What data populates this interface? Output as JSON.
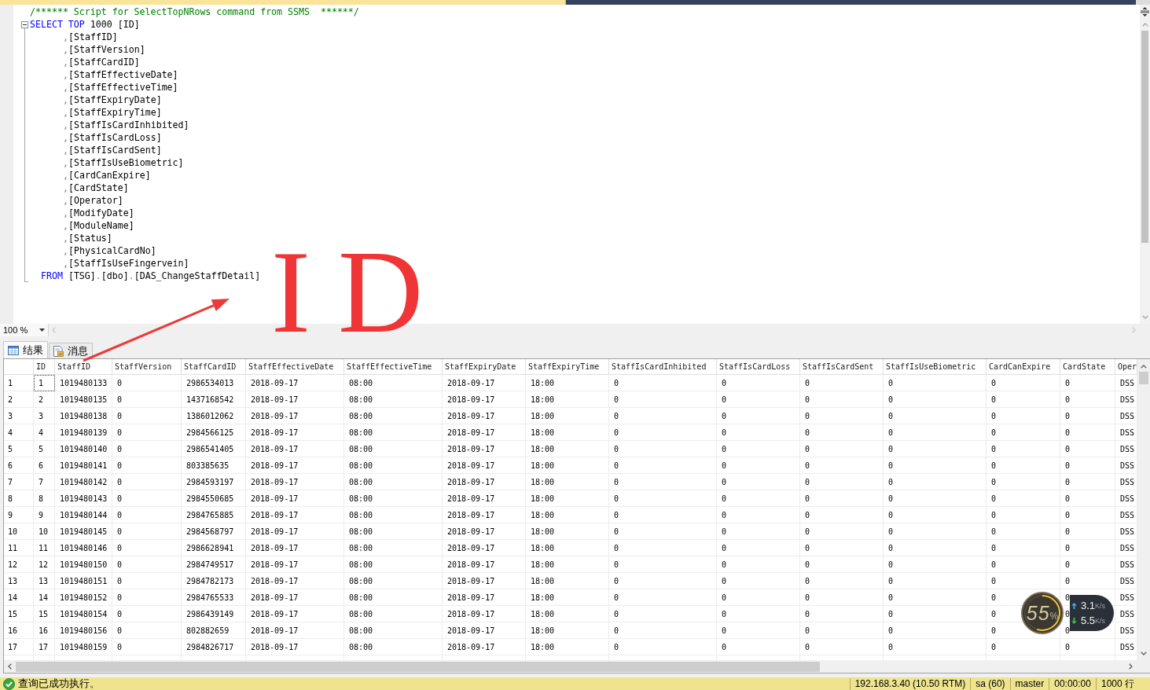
{
  "document_tabs": [
    {
      "selected": true
    },
    {
      "selected": false
    }
  ],
  "editor": {
    "fold_expanded": true,
    "lines": [
      {
        "kind": "head",
        "tokens": [
          {
            "kind": "comment",
            "text": "/****** Script for SelectTopNRows command from SSMS  ******/"
          }
        ]
      },
      {
        "kind": "head",
        "tokens": [
          {
            "kind": "keyword",
            "text": "SELECT TOP"
          },
          {
            "kind": "plain",
            "text": " 1000 [ID]"
          }
        ]
      },
      {
        "kind": "column",
        "tokens": [
          {
            "kind": "operator",
            "text": ","
          },
          {
            "kind": "plain",
            "text": "[StaffID]"
          }
        ]
      },
      {
        "kind": "column",
        "tokens": [
          {
            "kind": "operator",
            "text": ","
          },
          {
            "kind": "plain",
            "text": "[StaffVersion]"
          }
        ]
      },
      {
        "kind": "column",
        "tokens": [
          {
            "kind": "operator",
            "text": ","
          },
          {
            "kind": "plain",
            "text": "[StaffCardID]"
          }
        ]
      },
      {
        "kind": "column",
        "tokens": [
          {
            "kind": "operator",
            "text": ","
          },
          {
            "kind": "plain",
            "text": "[StaffEffectiveDate]"
          }
        ]
      },
      {
        "kind": "column",
        "tokens": [
          {
            "kind": "operator",
            "text": ","
          },
          {
            "kind": "plain",
            "text": "[StaffEffectiveTime]"
          }
        ]
      },
      {
        "kind": "column",
        "tokens": [
          {
            "kind": "operator",
            "text": ","
          },
          {
            "kind": "plain",
            "text": "[StaffExpiryDate]"
          }
        ]
      },
      {
        "kind": "column",
        "tokens": [
          {
            "kind": "operator",
            "text": ","
          },
          {
            "kind": "plain",
            "text": "[StaffExpiryTime]"
          }
        ]
      },
      {
        "kind": "column",
        "tokens": [
          {
            "kind": "operator",
            "text": ","
          },
          {
            "kind": "plain",
            "text": "[StaffIsCardInhibited]"
          }
        ]
      },
      {
        "kind": "column",
        "tokens": [
          {
            "kind": "operator",
            "text": ","
          },
          {
            "kind": "plain",
            "text": "[StaffIsCardLoss]"
          }
        ]
      },
      {
        "kind": "column",
        "tokens": [
          {
            "kind": "operator",
            "text": ","
          },
          {
            "kind": "plain",
            "text": "[StaffIsCardSent]"
          }
        ]
      },
      {
        "kind": "column",
        "tokens": [
          {
            "kind": "operator",
            "text": ","
          },
          {
            "kind": "plain",
            "text": "[StaffIsUseBiometric]"
          }
        ]
      },
      {
        "kind": "column",
        "tokens": [
          {
            "kind": "operator",
            "text": ","
          },
          {
            "kind": "plain",
            "text": "[CardCanExpire]"
          }
        ]
      },
      {
        "kind": "column",
        "tokens": [
          {
            "kind": "operator",
            "text": ","
          },
          {
            "kind": "plain",
            "text": "[CardState]"
          }
        ]
      },
      {
        "kind": "column",
        "tokens": [
          {
            "kind": "operator",
            "text": ","
          },
          {
            "kind": "plain",
            "text": "[Operator]"
          }
        ]
      },
      {
        "kind": "column",
        "tokens": [
          {
            "kind": "operator",
            "text": ","
          },
          {
            "kind": "plain",
            "text": "[ModifyDate]"
          }
        ]
      },
      {
        "kind": "column",
        "tokens": [
          {
            "kind": "operator",
            "text": ","
          },
          {
            "kind": "plain",
            "text": "[ModuleName]"
          }
        ]
      },
      {
        "kind": "column",
        "tokens": [
          {
            "kind": "operator",
            "text": ","
          },
          {
            "kind": "plain",
            "text": "[Status]"
          }
        ]
      },
      {
        "kind": "column",
        "tokens": [
          {
            "kind": "operator",
            "text": ","
          },
          {
            "kind": "plain",
            "text": "[PhysicalCardNo]"
          }
        ]
      },
      {
        "kind": "column",
        "tokens": [
          {
            "kind": "operator",
            "text": ","
          },
          {
            "kind": "plain",
            "text": "[StaffIsUseFingervein]"
          }
        ]
      },
      {
        "kind": "clause",
        "tokens": [
          {
            "kind": "keyword",
            "text": "FROM"
          },
          {
            "kind": "plain",
            "text": " [TSG]"
          },
          {
            "kind": "operator",
            "text": "."
          },
          {
            "kind": "plain",
            "text": "[dbo]"
          },
          {
            "kind": "operator",
            "text": "."
          },
          {
            "kind": "plain",
            "text": "[DAS_ChangeStaffDetail]"
          }
        ]
      }
    ]
  },
  "annotation": {
    "text": "ID"
  },
  "zoom": {
    "value": "100 %"
  },
  "result_tabs": [
    {
      "kind": "results",
      "label": "结果",
      "selected": true
    },
    {
      "kind": "messages",
      "label": "消息",
      "selected": false
    }
  ],
  "grid": {
    "columns": [
      "ID",
      "StaffID",
      "StaffVersion",
      "StaffCardID",
      "StaffEffectiveDate",
      "StaffEffectiveTime",
      "StaffExpiryDate",
      "StaffExpiryTime",
      "StaffIsCardInhibited",
      "StaffIsCardLoss",
      "StaffIsCardSent",
      "StaffIsUseBiometric",
      "CardCanExpire",
      "CardState",
      "Oper"
    ],
    "rows": [
      {
        "number": "1",
        "focused": true,
        "cells": [
          "1",
          "1019480133",
          "0",
          "2986534013",
          "2018-09-17",
          "08:00",
          "2018-09-17",
          "18:00",
          "0",
          "0",
          "0",
          "0",
          "0",
          "0",
          "DSS"
        ]
      },
      {
        "number": "2",
        "focused": false,
        "cells": [
          "2",
          "1019480135",
          "0",
          "1437168542",
          "2018-09-17",
          "08:00",
          "2018-09-17",
          "18:00",
          "0",
          "0",
          "0",
          "0",
          "0",
          "0",
          "DSS"
        ]
      },
      {
        "number": "3",
        "focused": false,
        "cells": [
          "3",
          "1019480138",
          "0",
          "1386012062",
          "2018-09-17",
          "08:00",
          "2018-09-17",
          "18:00",
          "0",
          "0",
          "0",
          "0",
          "0",
          "0",
          "DSS"
        ]
      },
      {
        "number": "4",
        "focused": false,
        "cells": [
          "4",
          "1019480139",
          "0",
          "2984566125",
          "2018-09-17",
          "08:00",
          "2018-09-17",
          "18:00",
          "0",
          "0",
          "0",
          "0",
          "0",
          "0",
          "DSS"
        ]
      },
      {
        "number": "5",
        "focused": false,
        "cells": [
          "5",
          "1019480140",
          "0",
          "2986541405",
          "2018-09-17",
          "08:00",
          "2018-09-17",
          "18:00",
          "0",
          "0",
          "0",
          "0",
          "0",
          "0",
          "DSS"
        ]
      },
      {
        "number": "6",
        "focused": false,
        "cells": [
          "6",
          "1019480141",
          "0",
          "803385635",
          "2018-09-17",
          "08:00",
          "2018-09-17",
          "18:00",
          "0",
          "0",
          "0",
          "0",
          "0",
          "0",
          "DSS"
        ]
      },
      {
        "number": "7",
        "focused": false,
        "cells": [
          "7",
          "1019480142",
          "0",
          "2984593197",
          "2018-09-17",
          "08:00",
          "2018-09-17",
          "18:00",
          "0",
          "0",
          "0",
          "0",
          "0",
          "0",
          "DSS"
        ]
      },
      {
        "number": "8",
        "focused": false,
        "cells": [
          "8",
          "1019480143",
          "0",
          "2984550685",
          "2018-09-17",
          "08:00",
          "2018-09-17",
          "18:00",
          "0",
          "0",
          "0",
          "0",
          "0",
          "0",
          "DSS"
        ]
      },
      {
        "number": "9",
        "focused": false,
        "cells": [
          "9",
          "1019480144",
          "0",
          "2984765885",
          "2018-09-17",
          "08:00",
          "2018-09-17",
          "18:00",
          "0",
          "0",
          "0",
          "0",
          "0",
          "0",
          "DSS"
        ]
      },
      {
        "number": "10",
        "focused": false,
        "cells": [
          "10",
          "1019480145",
          "0",
          "2984568797",
          "2018-09-17",
          "08:00",
          "2018-09-17",
          "18:00",
          "0",
          "0",
          "0",
          "0",
          "0",
          "0",
          "DSS"
        ]
      },
      {
        "number": "11",
        "focused": false,
        "cells": [
          "11",
          "1019480146",
          "0",
          "2986628941",
          "2018-09-17",
          "08:00",
          "2018-09-17",
          "18:00",
          "0",
          "0",
          "0",
          "0",
          "0",
          "0",
          "DSS"
        ]
      },
      {
        "number": "12",
        "focused": false,
        "cells": [
          "12",
          "1019480150",
          "0",
          "2984749517",
          "2018-09-17",
          "08:00",
          "2018-09-17",
          "18:00",
          "0",
          "0",
          "0",
          "0",
          "0",
          "0",
          "DSS"
        ]
      },
      {
        "number": "13",
        "focused": false,
        "cells": [
          "13",
          "1019480151",
          "0",
          "2984782173",
          "2018-09-17",
          "08:00",
          "2018-09-17",
          "18:00",
          "0",
          "0",
          "0",
          "0",
          "0",
          "0",
          "DSS"
        ]
      },
      {
        "number": "14",
        "focused": false,
        "cells": [
          "14",
          "1019480152",
          "0",
          "2984765533",
          "2018-09-17",
          "08:00",
          "2018-09-17",
          "18:00",
          "0",
          "0",
          "0",
          "0",
          "0",
          "0",
          "DSS"
        ]
      },
      {
        "number": "15",
        "focused": false,
        "cells": [
          "15",
          "1019480154",
          "0",
          "2986439149",
          "2018-09-17",
          "08:00",
          "2018-09-17",
          "18:00",
          "0",
          "0",
          "0",
          "0",
          "0",
          "0",
          "DSS"
        ]
      },
      {
        "number": "16",
        "focused": false,
        "cells": [
          "16",
          "1019480156",
          "0",
          "802882659",
          "2018-09-17",
          "08:00",
          "2018-09-17",
          "18:00",
          "0",
          "0",
          "0",
          "0",
          "0",
          "0",
          "DSS"
        ]
      },
      {
        "number": "17",
        "focused": false,
        "cells": [
          "17",
          "1019480159",
          "0",
          "2984826717",
          "2018-09-17",
          "08:00",
          "2018-09-17",
          "18:00",
          "0",
          "0",
          "0",
          "0",
          "0",
          "0",
          "DSS"
        ]
      }
    ]
  },
  "network_monitor": {
    "percent": "55",
    "percent_sign": "%",
    "level": 0.55,
    "speeds": [
      {
        "kind": "upload",
        "value": "3.1",
        "unit": "K/s"
      },
      {
        "kind": "download",
        "value": "5.5",
        "unit": "K/s"
      }
    ]
  },
  "status_bar": {
    "kind": "success",
    "message": "查询已成功执行。",
    "items": [
      "192.168.3.40 (10.50 RTM)",
      "sa (60)",
      "master",
      "00:00:00",
      "1000 行"
    ]
  }
}
